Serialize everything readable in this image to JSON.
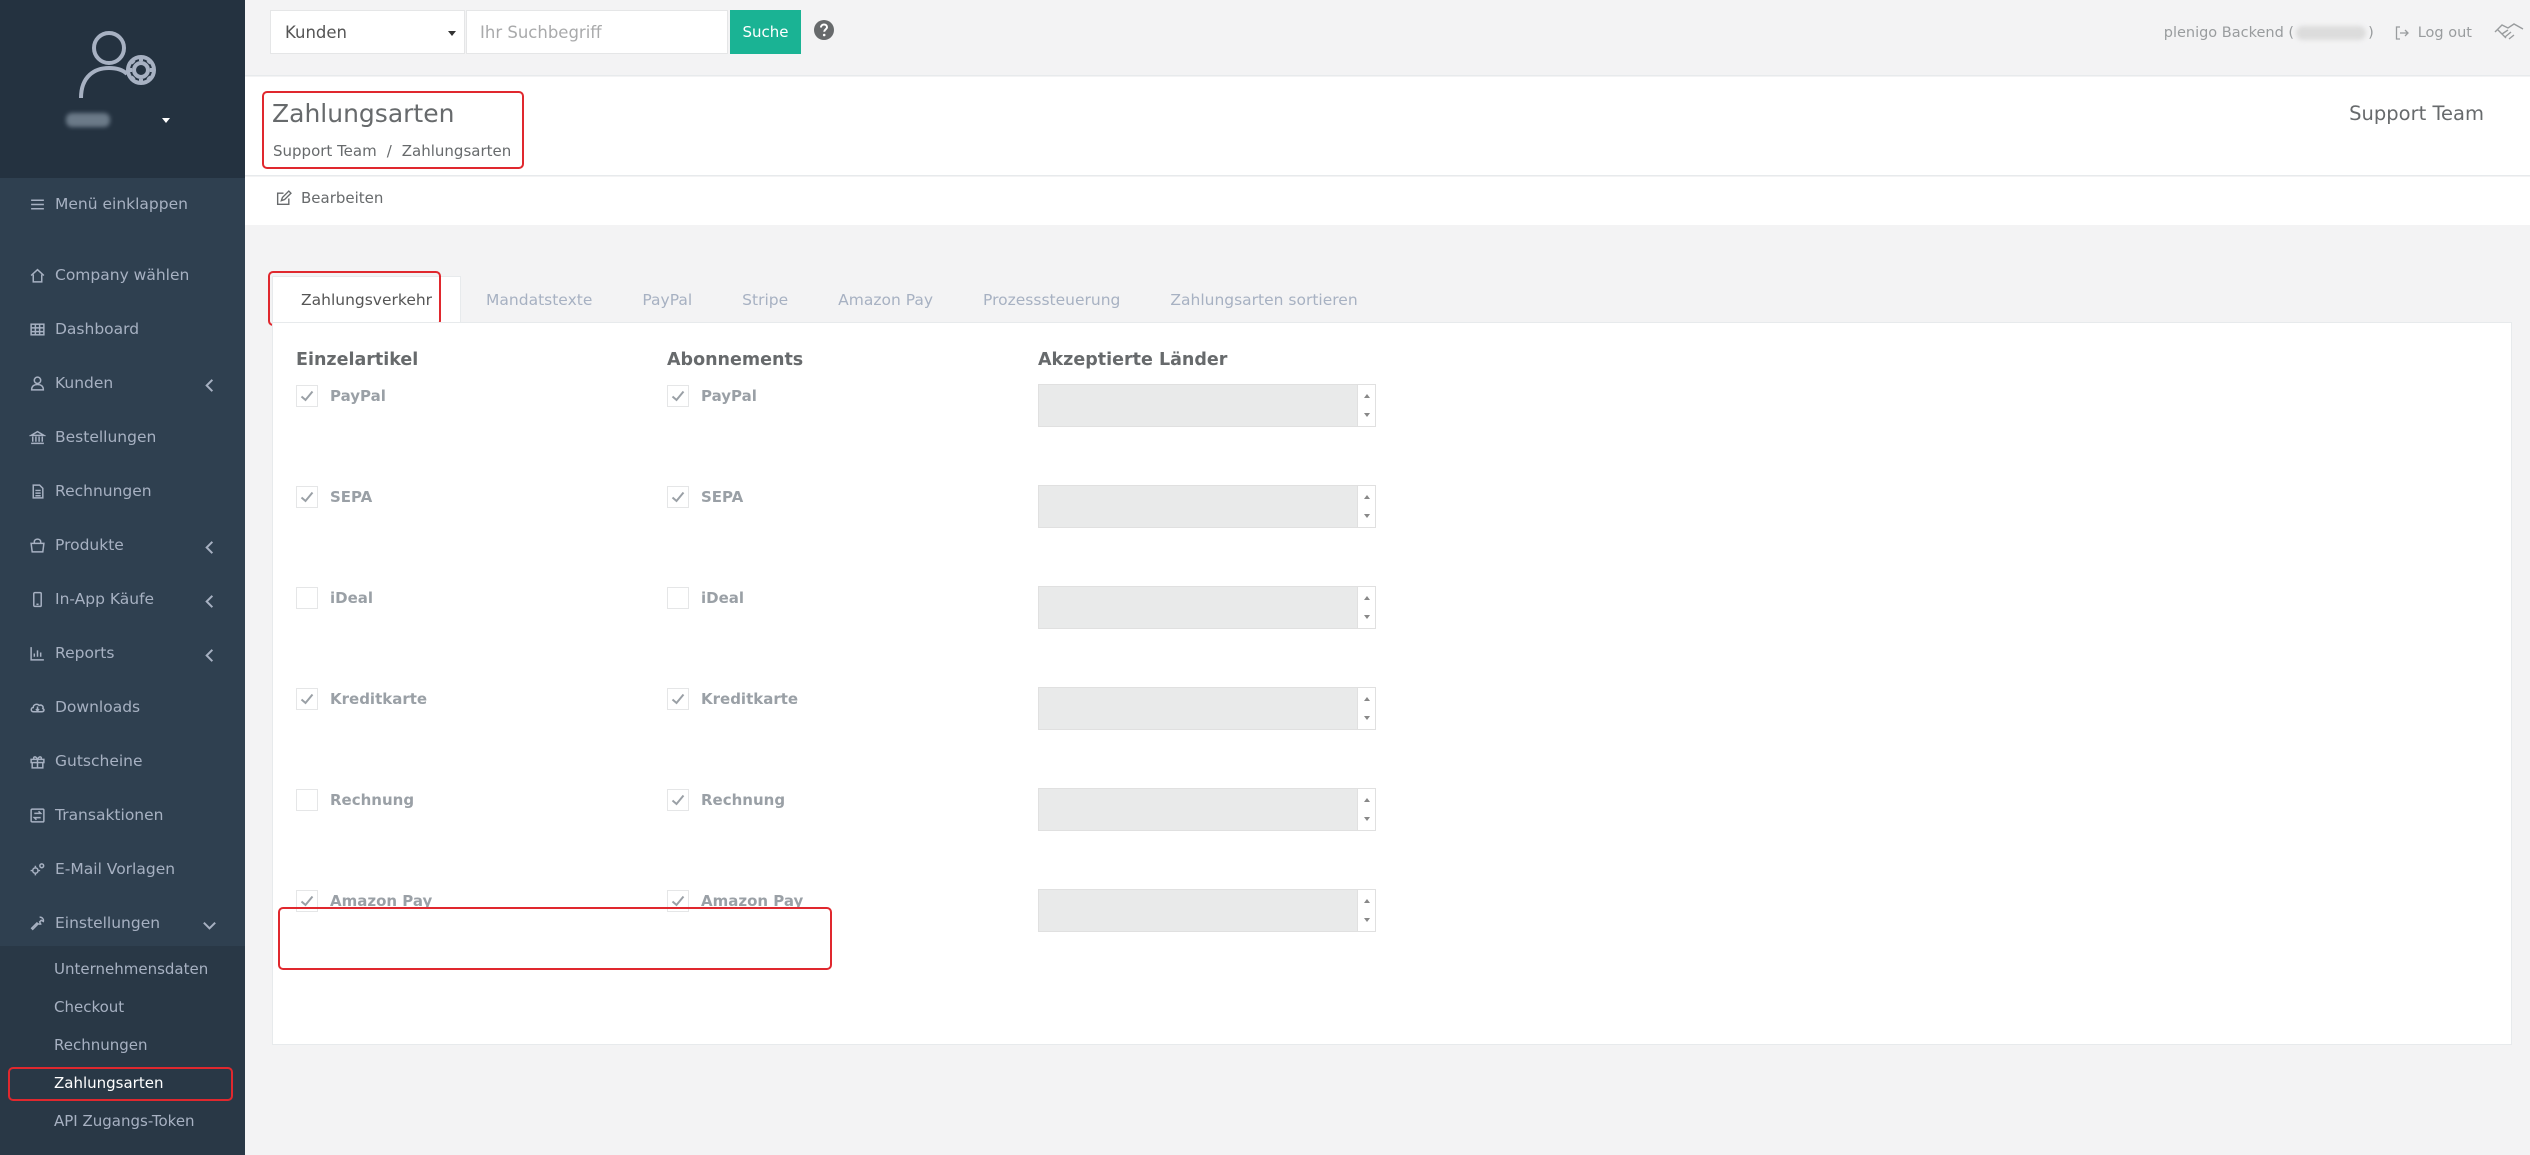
{
  "sidebar": {
    "collapse_label": "Menü einklappen",
    "items": [
      {
        "label": "Company wählen",
        "icon": "home-icon"
      },
      {
        "label": "Dashboard",
        "icon": "table-icon"
      },
      {
        "label": "Kunden",
        "icon": "user-icon"
      },
      {
        "label": "Bestellungen",
        "icon": "bank-icon"
      },
      {
        "label": "Rechnungen",
        "icon": "file-icon"
      },
      {
        "label": "Produkte",
        "icon": "shopping-bag-icon"
      },
      {
        "label": "In-App Käufe",
        "icon": "mobile-icon"
      },
      {
        "label": "Reports",
        "icon": "chart-icon"
      },
      {
        "label": "Downloads",
        "icon": "cloud-download-icon"
      },
      {
        "label": "Gutscheine",
        "icon": "gift-icon"
      },
      {
        "label": "Transaktionen",
        "icon": "exchange-icon"
      },
      {
        "label": "E-Mail Vorlagen",
        "icon": "cogs-icon"
      },
      {
        "label": "Einstellungen",
        "icon": "wrench-icon"
      }
    ],
    "subitems": [
      {
        "label": "Unternehmensdaten"
      },
      {
        "label": "Checkout"
      },
      {
        "label": "Rechnungen"
      },
      {
        "label": "Zahlungsarten"
      },
      {
        "label": "API Zugangs-Token"
      }
    ]
  },
  "topbar": {
    "search_scope": "Kunden",
    "search_placeholder": "Ihr Suchbegriff",
    "search_button": "Suche",
    "backend_label": "plenigo Backend (",
    "backend_close": ")",
    "logout_label": "Log out"
  },
  "heading": {
    "title": "Zahlungsarten",
    "breadcrumb": [
      "Support Team",
      "Zahlungsarten"
    ],
    "org_name": "Support Team"
  },
  "actions": {
    "edit_label": "Bearbeiten"
  },
  "tabs": [
    {
      "label": "Zahlungsverkehr"
    },
    {
      "label": "Mandatstexte"
    },
    {
      "label": "PayPal"
    },
    {
      "label": "Stripe"
    },
    {
      "label": "Amazon Pay"
    },
    {
      "label": "Prozesssteuerung"
    },
    {
      "label": "Zahlungsarten sortieren"
    }
  ],
  "settings": {
    "col_single": "Einzelartikel",
    "col_subscription": "Abonnements",
    "col_countries": "Akzeptierte Länder",
    "rows": [
      {
        "method": "PayPal",
        "single": true,
        "subscription": true
      },
      {
        "method": "SEPA",
        "single": true,
        "subscription": true
      },
      {
        "method": "iDeal",
        "single": false,
        "subscription": false
      },
      {
        "method": "Kreditkarte",
        "single": true,
        "subscription": true
      },
      {
        "method": "Rechnung",
        "single": false,
        "subscription": true
      },
      {
        "method": "Amazon Pay",
        "single": true,
        "subscription": true
      }
    ]
  },
  "colors": {
    "sidebar_bg": "#2f4050",
    "accent": "#1ab394",
    "highlight": "#e0282e"
  }
}
